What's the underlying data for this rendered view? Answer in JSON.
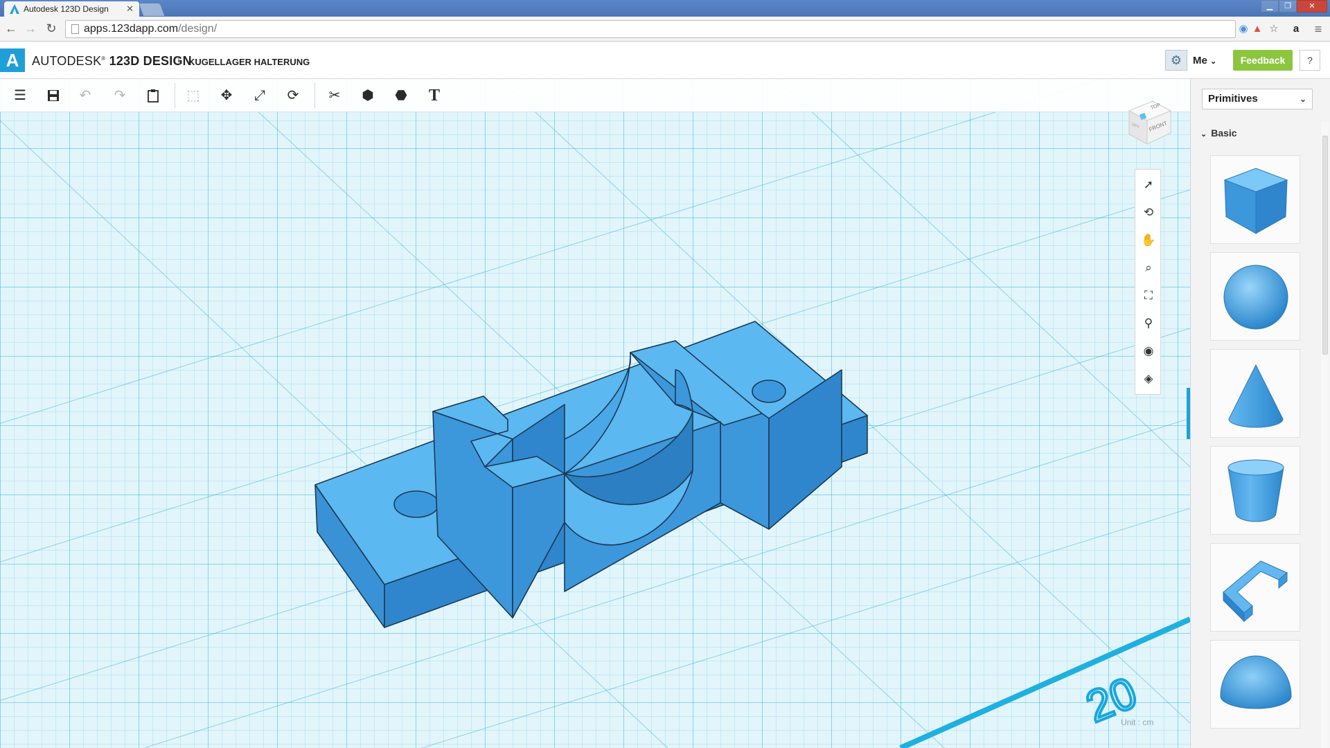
{
  "browser": {
    "tab_title": "Autodesk 123D Design",
    "url_host": "apps.123dapp.com",
    "url_path": "/design/"
  },
  "app": {
    "brand_autodesk": "AUTODESK",
    "brand_product": "123D DESIGN",
    "separator": "\\",
    "project_name": "KUGELLAGER HALTERUNG",
    "user_label": "Me",
    "feedback_label": "Feedback",
    "help_label": "?"
  },
  "toolbar": {
    "tools": [
      "menu-icon",
      "save-icon",
      "undo-icon",
      "redo-icon",
      "clipboard-icon",
      "select-box-icon",
      "move-icon",
      "scale-icon",
      "refresh-icon",
      "modify-icon",
      "combine-icon",
      "group-icon",
      "text-icon"
    ],
    "text_tool_label": "T"
  },
  "viewcube": {
    "top_label": "TOP",
    "front_label": "FRONT",
    "left_label": "LEFT"
  },
  "navigation": [
    "pointer-icon",
    "orbit-icon",
    "pan-icon",
    "zoom-icon",
    "fit-icon",
    "zoom-selected-icon",
    "visibility-icon",
    "material-icon"
  ],
  "viewport": {
    "unit_label": "Unit : cm",
    "ruler_label": "20"
  },
  "panel": {
    "dropdown_label": "Primitives",
    "section_label": "Basic",
    "primitives": [
      "box",
      "sphere",
      "cone",
      "cylinder",
      "polygon-bracket",
      "hemisphere"
    ]
  },
  "colors": {
    "accent": "#1f9fd8",
    "model": "#3da4e6",
    "feedback": "#8cc63f",
    "grid_bg": "#e2f5fb"
  }
}
